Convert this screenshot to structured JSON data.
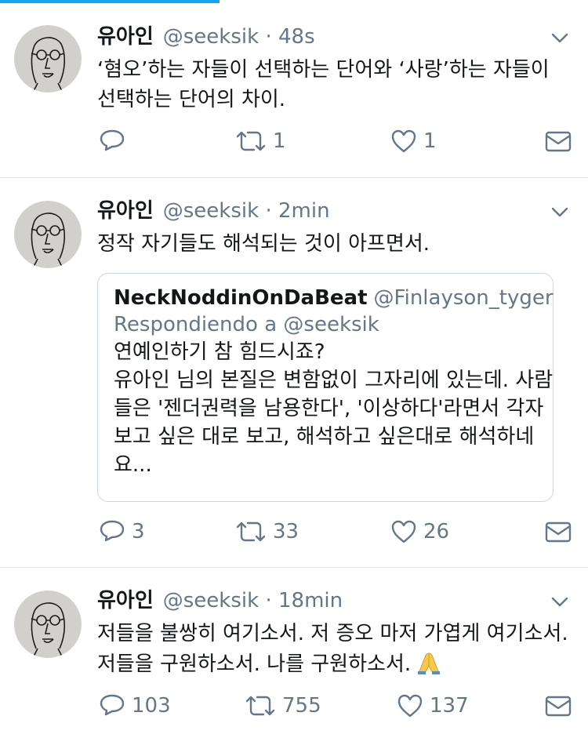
{
  "tweets": [
    {
      "name": "유아인",
      "handle": "@seeksik",
      "time": "48s",
      "text_line1": "‘혐오’하는 자들이 선택하는 단어와 ‘사랑’하는 자들이",
      "text_line2": "선택하는 단어의 차이.",
      "replies": "",
      "retweets": "1",
      "likes": "1"
    },
    {
      "name": "유아인",
      "handle": "@seeksik",
      "time": "2min",
      "text_line1": "정작 자기들도 해석되는 것이 아프면서.",
      "quote": {
        "name": "NeckNoddinOnDaBeat",
        "handle": "@Finlayson_tyger",
        "reply_to": "Respondiendo a @seeksik",
        "lines": [
          "연예인하기 참 힘드시죠?",
          "유아인 님의 본질은 변함없이 그자리에 있는데. 사람",
          "들은 '젠더권력을 남용한다', '이상하다'라면서 각자",
          "보고 싶은 대로 보고, 해석하고 싶은대로 해석하네",
          "요..."
        ]
      },
      "replies": "3",
      "retweets": "33",
      "likes": "26"
    },
    {
      "name": "유아인",
      "handle": "@seeksik",
      "time": "18min",
      "text_line1": "저들을 불쌍히 여기소서. 저 증오 마저 가엽게 여기소서.",
      "text_line2": "저들을 구원하소서. 나를 구원하소서.",
      "emoji": "folded-hands",
      "replies": "103",
      "retweets": "755",
      "likes": "137"
    }
  ],
  "colors": {
    "accent": "#1da1f2",
    "muted": "#657786",
    "text": "#14171a",
    "divider": "#e1e8ed"
  }
}
